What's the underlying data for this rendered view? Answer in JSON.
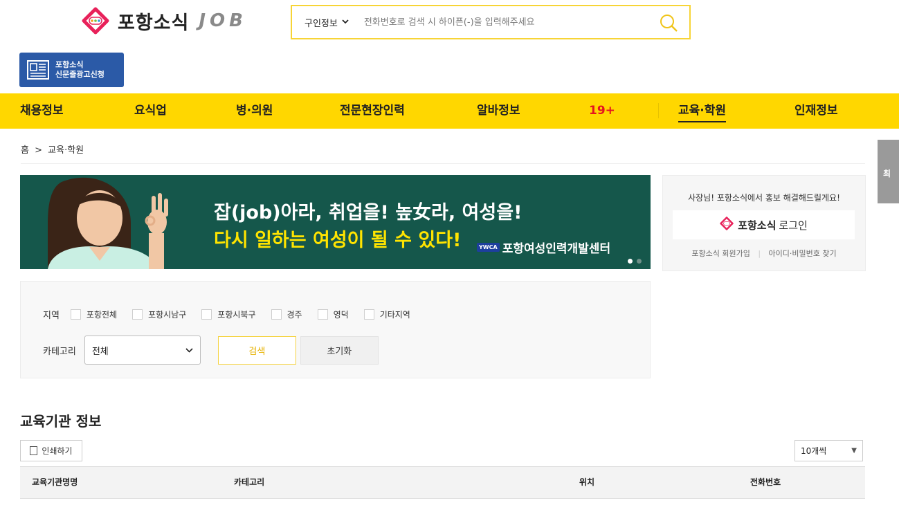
{
  "header": {
    "logo_text": "포항소식",
    "logo_job": "JOB",
    "search": {
      "category": "구인정보",
      "placeholder": "전화번호로 검색 시 하이픈(-)을 입력해주세요"
    },
    "ad_button": {
      "line1": "포항소식",
      "line2": "신문줄광고신청"
    }
  },
  "nav": {
    "items": [
      {
        "label": "채용정보"
      },
      {
        "label": "요식업"
      },
      {
        "label": "병·의원"
      },
      {
        "label": "전문현장인력"
      },
      {
        "label": "알바정보"
      },
      {
        "label": "19+"
      },
      {
        "label": "교육·학원"
      },
      {
        "label": "인재정보"
      }
    ],
    "active": "교육·학원"
  },
  "breadcrumb": {
    "home": "홈",
    "separator": ">",
    "current": "교육·학원"
  },
  "side_tab": {
    "label": "최"
  },
  "banner": {
    "line1": "잡(job)아라, 취업을! 높女라, 여성을!",
    "line2": "다시 일하는 여성이 될 수 있다!",
    "org_badge": "YWCA",
    "org": "포항여성인력개발센터",
    "slide_count": 2,
    "active_slide": 1
  },
  "login": {
    "message": "사장님! 포항소식에서 홍보 해결해드릴게요!",
    "brand": "포항소식",
    "action": "로그인",
    "signup": "포항소식 회원가입",
    "find": "아이디·비밀번호 찾기"
  },
  "filter": {
    "region_label": "지역",
    "regions": [
      "포항전체",
      "포항시남구",
      "포항시북구",
      "경주",
      "영덕",
      "기타지역"
    ],
    "category_label": "카테고리",
    "category_value": "전체",
    "search_label": "검색",
    "reset_label": "초기화"
  },
  "section": {
    "title": "교육기관 정보",
    "print_label": "인쇄하기",
    "per_page": "10개씩",
    "columns": [
      "교육기관명명",
      "카테고리",
      "위치",
      "전화번호"
    ]
  },
  "colors": {
    "nav_bg": "#ffd700",
    "nav_highlight": "#e5141f",
    "search_border": "#f7d436",
    "banner_bg": "#15574b",
    "banner_accent": "#ffe400",
    "ad_button_bg": "#2b5aa7"
  }
}
